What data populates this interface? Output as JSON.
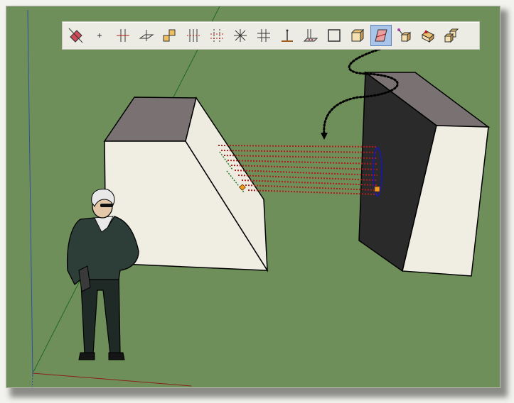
{
  "app": {
    "viewport_background": "#6f8f5a",
    "toolbar_background": "#ecece4"
  },
  "toolbar": {
    "tools": [
      {
        "name": "eraser-icon"
      },
      {
        "name": "point-icon"
      },
      {
        "name": "intersect-icon"
      },
      {
        "name": "plane-icon"
      },
      {
        "name": "offset-step-icon"
      },
      {
        "name": "parallel-lines-icon"
      },
      {
        "name": "dashed-grid-icon"
      },
      {
        "name": "star-lines-icon"
      },
      {
        "name": "hash-grid-icon"
      },
      {
        "name": "vertical-pin-icon"
      },
      {
        "name": "drop-lines-icon"
      },
      {
        "name": "rectangle-icon"
      },
      {
        "name": "box-face-icon"
      },
      {
        "name": "skew-plane-icon",
        "active": true
      },
      {
        "name": "move-box-icon"
      },
      {
        "name": "push-box-icon"
      },
      {
        "name": "stacked-boxes-icon"
      }
    ]
  },
  "scene": {
    "colors": {
      "box_top": "#7a7272",
      "box_front": "#f0eee2",
      "box_side_dark": "#2a2a2a",
      "dotted_lines": "#b21c1c",
      "guide_ellipse": "#1a1a9a",
      "endpoint_marker": "#f09a20"
    }
  }
}
